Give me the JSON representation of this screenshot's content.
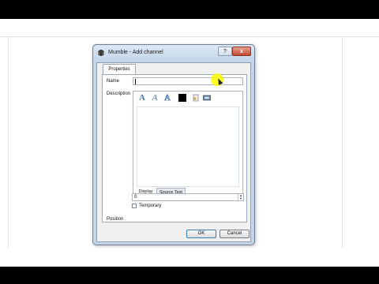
{
  "window": {
    "title": "Mumble - Add channel",
    "help_label": "?",
    "close_label": "x"
  },
  "tabs": {
    "properties": "Properties"
  },
  "form": {
    "name_label": "Name",
    "name_value": "",
    "description_label": "Description",
    "position_label": "Position",
    "position_value": "0",
    "temporary_label": "Temporary",
    "temporary_checked": false
  },
  "editor": {
    "toolbar": [
      {
        "icon": "bold-a-icon",
        "glyph": "A"
      },
      {
        "icon": "italic-a-icon",
        "glyph": "A"
      },
      {
        "icon": "outline-a-icon",
        "glyph": "A"
      },
      {
        "icon": "color-swatch-icon",
        "color": "#000000"
      },
      {
        "icon": "insert-link-icon"
      },
      {
        "icon": "insert-image-icon"
      }
    ],
    "subtabs": {
      "display": "Display",
      "source": "Source Text"
    }
  },
  "buttons": {
    "ok": "OK",
    "cancel": "Cancel"
  },
  "spin": {
    "up": "▲",
    "down": "▼"
  }
}
